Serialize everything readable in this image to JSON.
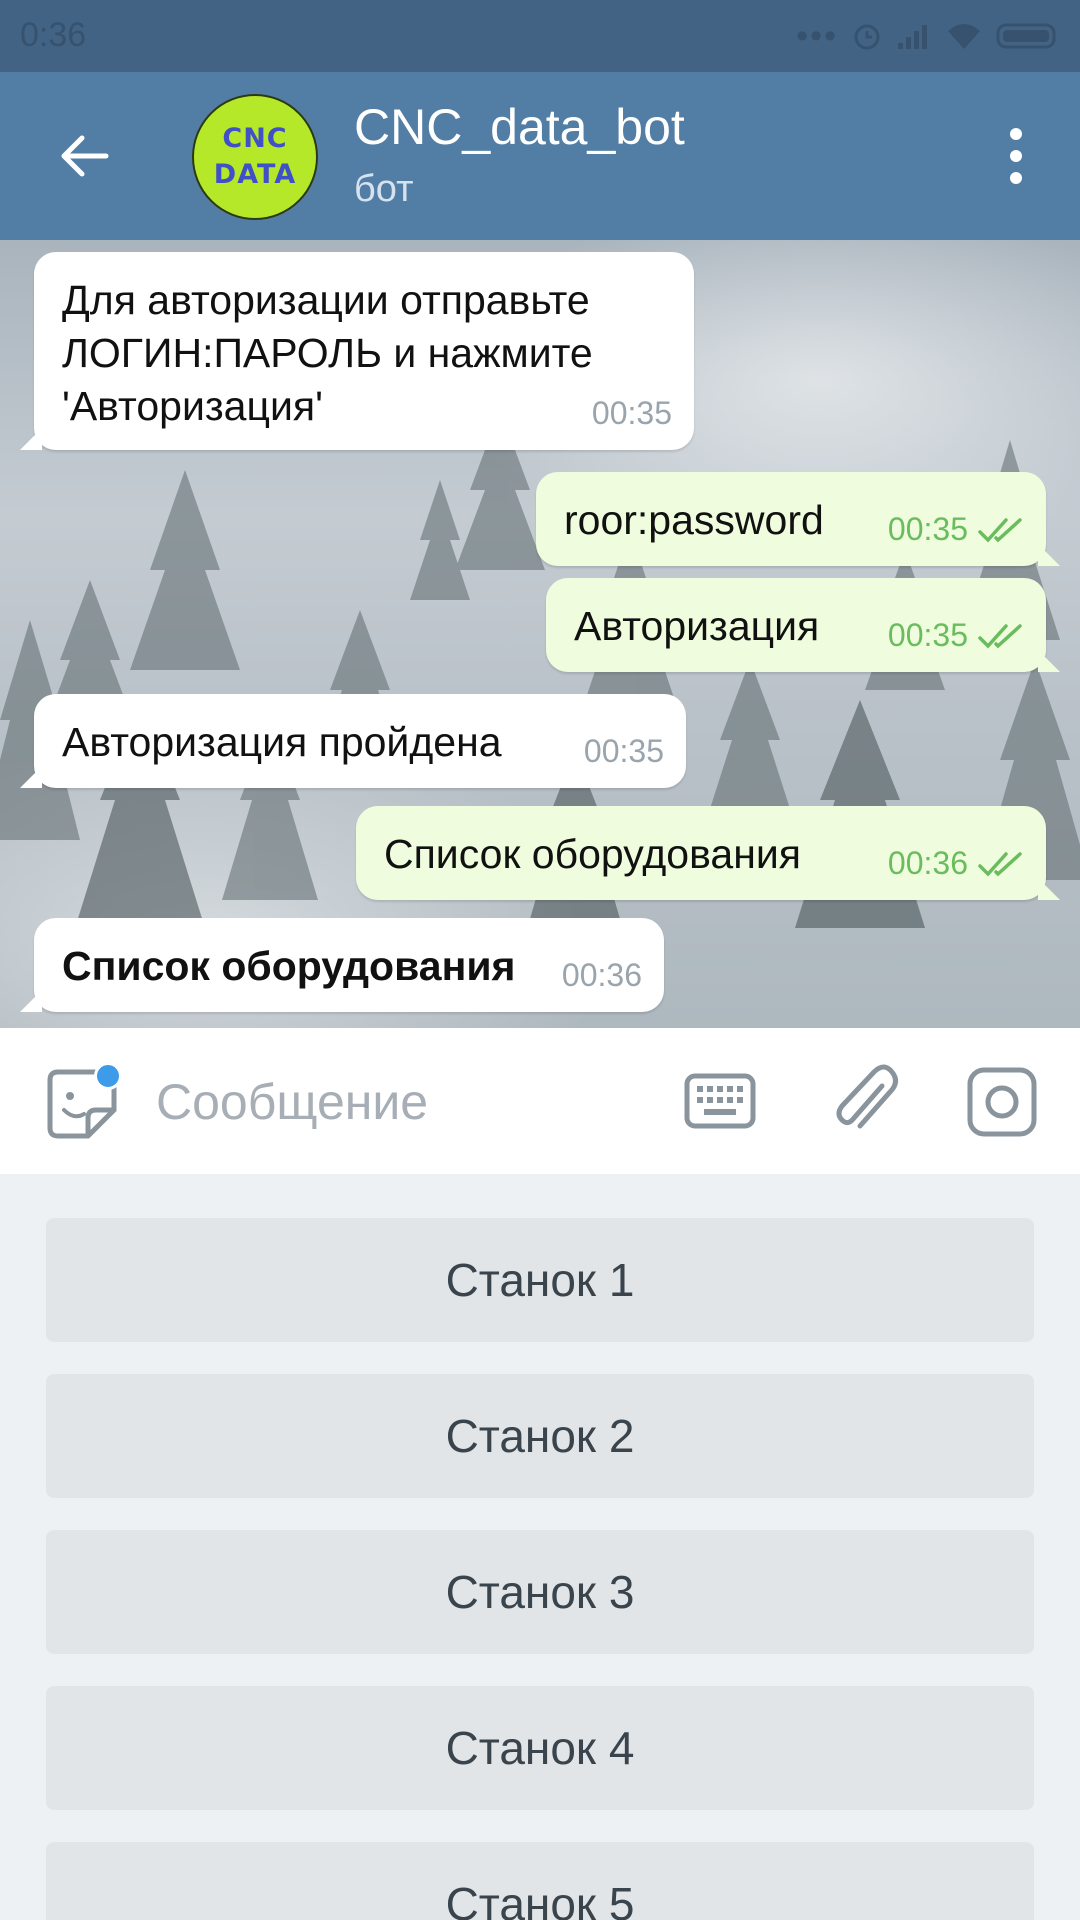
{
  "status_bar": {
    "time": "0:36"
  },
  "header": {
    "title": "CNC_data_bot",
    "subtitle": "бот",
    "avatar_line1": "CNC",
    "avatar_line2": "DATA"
  },
  "messages": [
    {
      "dir": "in",
      "text": "Для авторизации отправьте\nЛОГИН:ПАРОЛЬ и нажмите\n'Авторизация'",
      "time": "00:35"
    },
    {
      "dir": "out",
      "text": "roor:password",
      "time": "00:35",
      "read": true
    },
    {
      "dir": "out",
      "text": "Авторизация",
      "time": "00:35",
      "read": true
    },
    {
      "dir": "in",
      "text": "Авторизация пройдена",
      "time": "00:35"
    },
    {
      "dir": "out",
      "text": "Список оборудования",
      "time": "00:36",
      "read": true
    },
    {
      "dir": "in",
      "text": "Список оборудования",
      "time": "00:36",
      "bold": true
    }
  ],
  "input": {
    "placeholder": "Сообщение",
    "value": ""
  },
  "icons": {
    "back": "arrow-left-icon",
    "menu": "more-vertical-icon",
    "emoji": "sticker-icon",
    "keyboard": "keyboard-icon",
    "attach": "paperclip-icon",
    "camera": "camera-icon",
    "read": "double-check-icon"
  },
  "bot_keyboard": [
    "Станок 1",
    "Станок 2",
    "Станок 3",
    "Станок 4",
    "Станок 5"
  ],
  "colors": {
    "header": "#527ea6",
    "status_bar": "#436384",
    "outgoing_bubble": "#effdde",
    "incoming_bubble": "#ffffff",
    "check": "#6abc5e",
    "avatar": "#b6e82a"
  }
}
